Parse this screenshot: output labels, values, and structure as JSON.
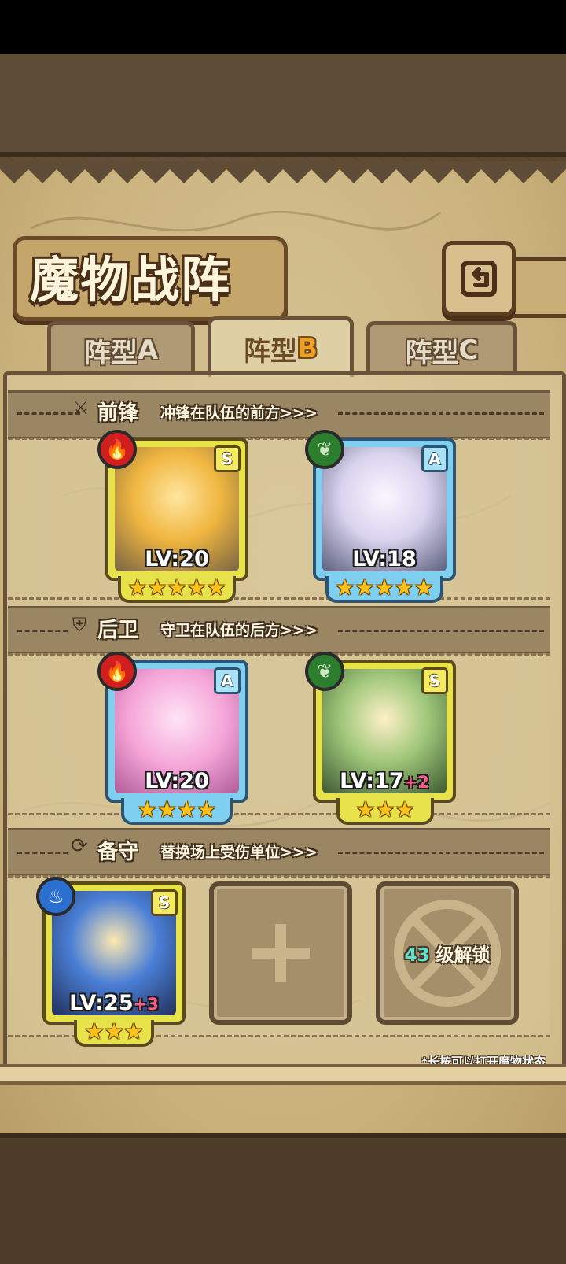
{
  "page": {
    "title": "魔物战阵"
  },
  "tabs": [
    {
      "label_main": "阵型",
      "label_letter": "A",
      "active": false
    },
    {
      "label_main": "阵型",
      "label_letter": "B",
      "active": true
    },
    {
      "label_main": "阵型",
      "label_letter": "C",
      "active": false
    }
  ],
  "sections": {
    "front": {
      "title": "前锋",
      "subtitle": "冲锋在队伍的前方>>>"
    },
    "back": {
      "title": "后卫",
      "subtitle": "守卫在队伍的后方>>>"
    },
    "reserve": {
      "title": "备守",
      "subtitle": "替换场上受伤单位>>>"
    }
  },
  "units": [
    {
      "id": "front-1",
      "element": "fire",
      "rank": "S",
      "level": "LV:20",
      "bonus": "",
      "stars": 5,
      "frame": "gold",
      "palette": "#f0b640"
    },
    {
      "id": "front-2",
      "element": "leaf",
      "rank": "A",
      "level": "LV:18",
      "bonus": "",
      "stars": 5,
      "frame": "blue",
      "palette": "#d9d3ee"
    },
    {
      "id": "back-1",
      "element": "fire",
      "rank": "A",
      "level": "LV:20",
      "bonus": "",
      "stars": 4,
      "frame": "blue",
      "palette": "#f5a5d8"
    },
    {
      "id": "back-2",
      "element": "leaf",
      "rank": "S",
      "level": "LV:17",
      "bonus": "+2",
      "stars": 3,
      "frame": "gold",
      "palette": "#9fc77a"
    },
    {
      "id": "reserve-1",
      "element": "water",
      "rank": "S",
      "level": "LV:25",
      "bonus": "+3",
      "stars": 3,
      "frame": "gold",
      "palette": "#4a7fd6"
    }
  ],
  "reserve_slots": {
    "add_slot_icon": "plus-icon",
    "locked_slot": {
      "unlock_level": "43",
      "unlock_text": "级解锁"
    }
  },
  "footer": {
    "hint": "*长按可以打开魔物状态"
  },
  "colors": {
    "accent": "#f0a020",
    "fire": "#d11f1f",
    "leaf": "#2d7d2e",
    "water": "#2b6fd1"
  }
}
